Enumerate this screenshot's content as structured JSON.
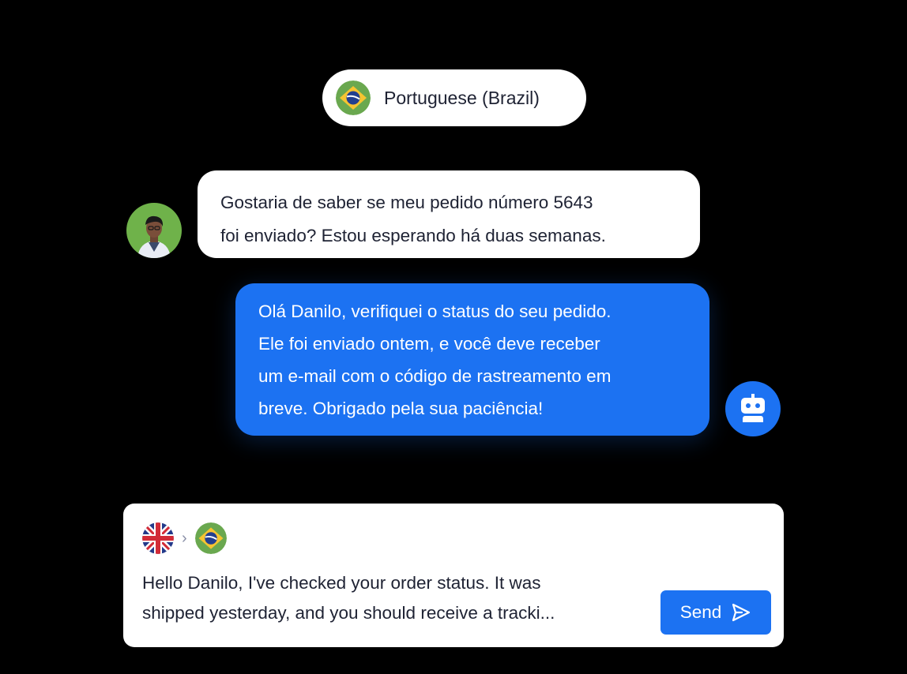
{
  "language_pill": {
    "label": "Portuguese (Brazil)",
    "flag_icon": "brazil-flag-icon"
  },
  "messages": [
    {
      "sender": "customer",
      "avatar_icon": "customer-avatar",
      "lines": [
        "Gostaria de saber se meu pedido número 5643",
        "foi enviado? Estou esperando há duas semanas."
      ]
    },
    {
      "sender": "bot",
      "avatar_icon": "robot-icon",
      "lines": [
        "Olá Danilo, verifiquei o status do seu pedido.",
        "Ele foi enviado ontem, e você deve receber",
        "um e-mail com o código de rastreamento em",
        "breve. Obrigado pela sua paciência!"
      ]
    }
  ],
  "composer": {
    "source_flag_icon": "uk-flag-icon",
    "arrow_icon": "chevron-right-icon",
    "target_flag_icon": "brazil-flag-icon",
    "text_lines": [
      "Hello Danilo, I've checked your order status. It was",
      "shipped yesterday, and you should receive a tracki..."
    ],
    "send_label": "Send",
    "send_icon": "send-icon"
  },
  "colors": {
    "background": "#000000",
    "accent": "#1c72f2",
    "bubble": "#ffffff",
    "text": "#1e2233",
    "avatar_bg": "#6fb24a"
  }
}
